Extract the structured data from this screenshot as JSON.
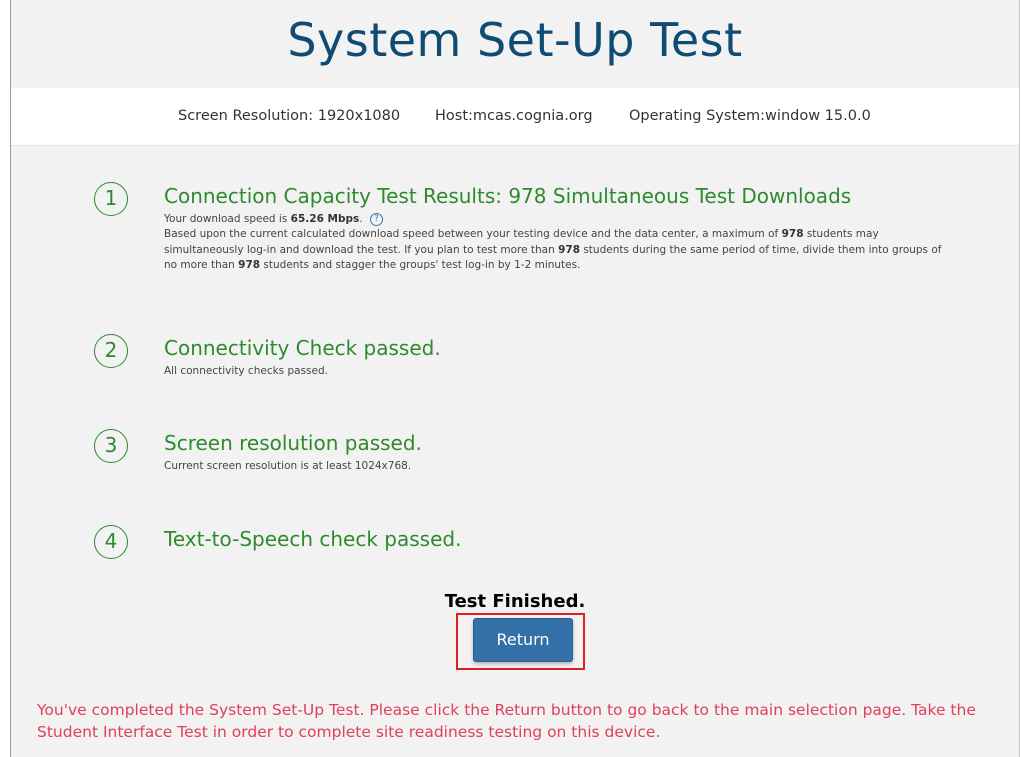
{
  "page": {
    "title": "System Set-Up Test"
  },
  "info": {
    "screen_resolution": "Screen Resolution: 1920x1080",
    "host": "Host:mcas.cognia.org",
    "os": "Operating System:window 15.0.0"
  },
  "steps": [
    {
      "number": "1",
      "title": "Connection Capacity Test Results: 978 Simultaneous Test Downloads",
      "speed_prefix": "Your download speed is ",
      "speed_value": "65.26 Mbps",
      "speed_suffix": ".",
      "help_icon": "question-circle-icon",
      "detail": {
        "p1": "Based upon the current calculated download speed between your testing device and the data center, a maximum of ",
        "n1": "978",
        "p2": " students may simultaneously log-in and download the test. If you plan to test more than ",
        "n2": "978",
        "p3": " students during the same period of time, divide them into groups of no more than ",
        "n3": "978",
        "p4": " students and stagger the groups' test log-in by 1-2 minutes."
      }
    },
    {
      "number": "2",
      "title": "Connectivity Check passed.",
      "subtitle": "All connectivity checks passed."
    },
    {
      "number": "3",
      "title": "Screen resolution passed.",
      "subtitle": "Current screen resolution is at least 1024x768."
    },
    {
      "number": "4",
      "title": "Text-to-Speech check passed."
    }
  ],
  "status": {
    "finished": "Test Finished.",
    "return_label": "Return"
  },
  "message": "You've completed the System Set-Up Test. Please click the Return button to go back to the main selection page. Take the Student Interface Test in order to complete site readiness testing on this device.",
  "colors": {
    "title": "#0f4b73",
    "success": "#2d8a2d",
    "button": "#3470a8",
    "highlight_outline": "#e02020",
    "message": "#e0405a"
  }
}
